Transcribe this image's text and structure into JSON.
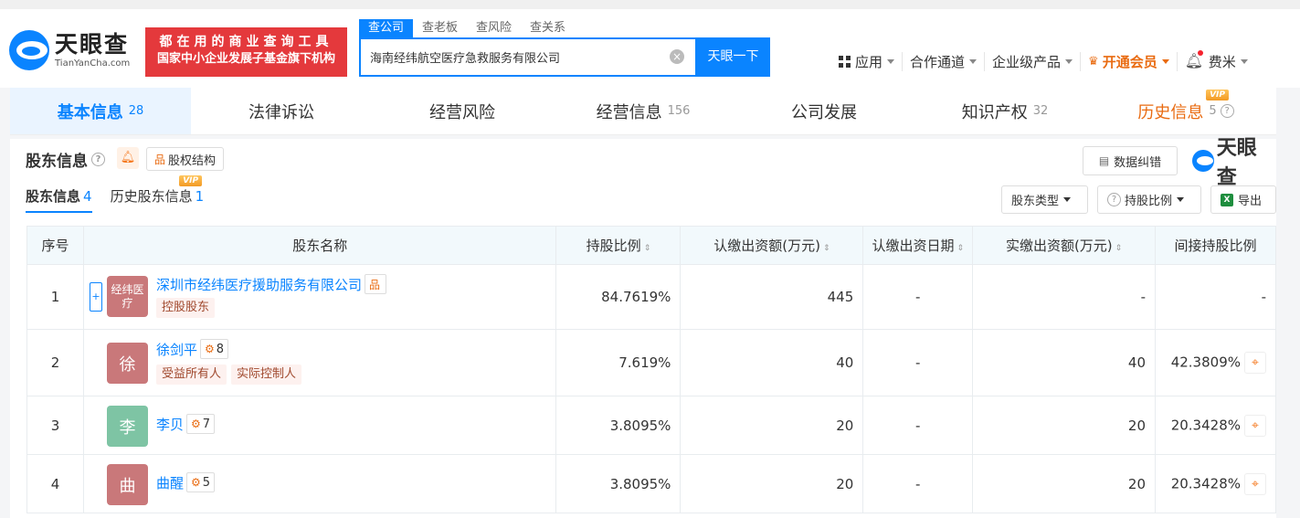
{
  "header": {
    "logo_cn": "天眼查",
    "logo_en": "TianYanCha.com",
    "slogan_line1": "都在用的商业查询工具",
    "slogan_line2": "国家中小企业发展子基金旗下机构",
    "search_tabs": [
      "查公司",
      "查老板",
      "查风险",
      "查关系"
    ],
    "search_value": "海南经纬航空医疗急救服务有限公司",
    "search_button": "天眼一下",
    "nav": {
      "apps": "应用",
      "channels": "合作通道",
      "enterprise": "企业级产品",
      "vip": "开通会员",
      "user": "费米"
    }
  },
  "main_tabs": [
    {
      "label": "基本信息",
      "count": "28"
    },
    {
      "label": "法律诉讼",
      "count": ""
    },
    {
      "label": "经营风险",
      "count": ""
    },
    {
      "label": "经营信息",
      "count": "156"
    },
    {
      "label": "公司发展",
      "count": ""
    },
    {
      "label": "知识产权",
      "count": "32"
    },
    {
      "label": "历史信息",
      "count": "5"
    }
  ],
  "vip_label": "VIP",
  "section": {
    "title": "股东信息",
    "structure_button": "股权结构",
    "fix_button": "数据纠错",
    "brand": "天眼查",
    "sub_tabs": [
      {
        "label": "股东信息",
        "count": "4"
      },
      {
        "label": "历史股东信息",
        "count": "1"
      }
    ],
    "filters": {
      "type": "股东类型",
      "ratio": "持股比例",
      "export": "导出"
    }
  },
  "table": {
    "headers": [
      "序号",
      "股东名称",
      "持股比例",
      "认缴出资额(万元)",
      "认缴出资日期",
      "实缴出资额(万元)",
      "间接持股比例"
    ],
    "rows": [
      {
        "idx": "1",
        "avatar": "经纬医疗",
        "avatar_color": "#c9787a",
        "name": "深圳市经纬医疗援助服务有限公司",
        "link_count": "",
        "tags": [
          "控股股东"
        ],
        "ratio": "84.7619%",
        "subscribed": "445",
        "date": "-",
        "paid": "-",
        "indirect": "-"
      },
      {
        "idx": "2",
        "avatar": "徐",
        "avatar_color": "#c9787a",
        "name": "徐剑平",
        "link_count": "8",
        "tags": [
          "受益所有人",
          "实际控制人"
        ],
        "ratio": "7.619%",
        "subscribed": "40",
        "date": "-",
        "paid": "40",
        "indirect": "42.3809%"
      },
      {
        "idx": "3",
        "avatar": "李",
        "avatar_color": "#7ec4a4",
        "name": "李贝",
        "link_count": "7",
        "tags": [],
        "ratio": "3.8095%",
        "subscribed": "20",
        "date": "-",
        "paid": "20",
        "indirect": "20.3428%"
      },
      {
        "idx": "4",
        "avatar": "曲",
        "avatar_color": "#c9787a",
        "name": "曲醒",
        "link_count": "5",
        "tags": [],
        "ratio": "3.8095%",
        "subscribed": "20",
        "date": "-",
        "paid": "20",
        "indirect": "20.3428%"
      }
    ]
  }
}
